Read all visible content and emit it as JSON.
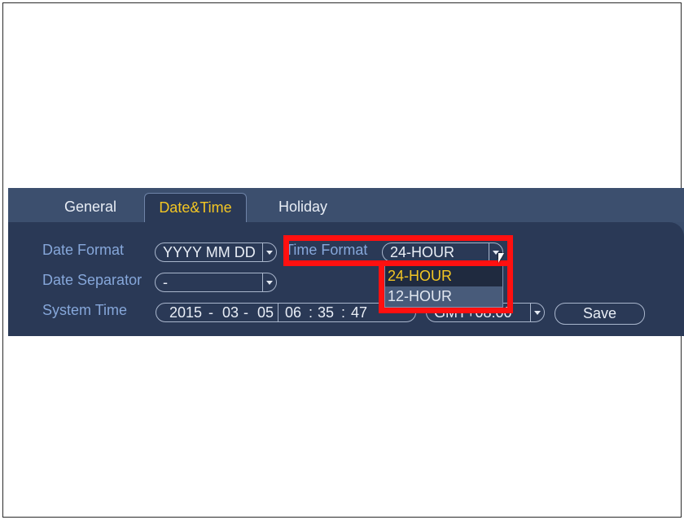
{
  "tabs": {
    "general": "General",
    "datetime": "Date&Time",
    "holiday": "Holiday"
  },
  "form": {
    "date_format_label": "Date Format",
    "date_format_value": "YYYY MM DD",
    "time_format_label": "Time Format",
    "time_format_value": "24-HOUR",
    "date_separator_label": "Date Separator",
    "date_separator_value": "-",
    "system_time_label": "System Time",
    "system_date": {
      "year": "2015",
      "dash1": "-",
      "month": "03",
      "dash2": "-",
      "day": "05"
    },
    "system_clock": {
      "hour": "06",
      "colon1": ":",
      "minute": "35",
      "colon2": ":",
      "second": "47"
    },
    "timezone_value": "GMT+08:00"
  },
  "dropdown": {
    "options": [
      "24-HOUR",
      "12-HOUR"
    ],
    "selected_index": 0
  },
  "buttons": {
    "save": "Save"
  },
  "colors": {
    "accent_yellow": "#f3c623",
    "highlight_red": "#ff1010",
    "panel_bg": "#2a3956",
    "label_blue": "#86a7da"
  }
}
